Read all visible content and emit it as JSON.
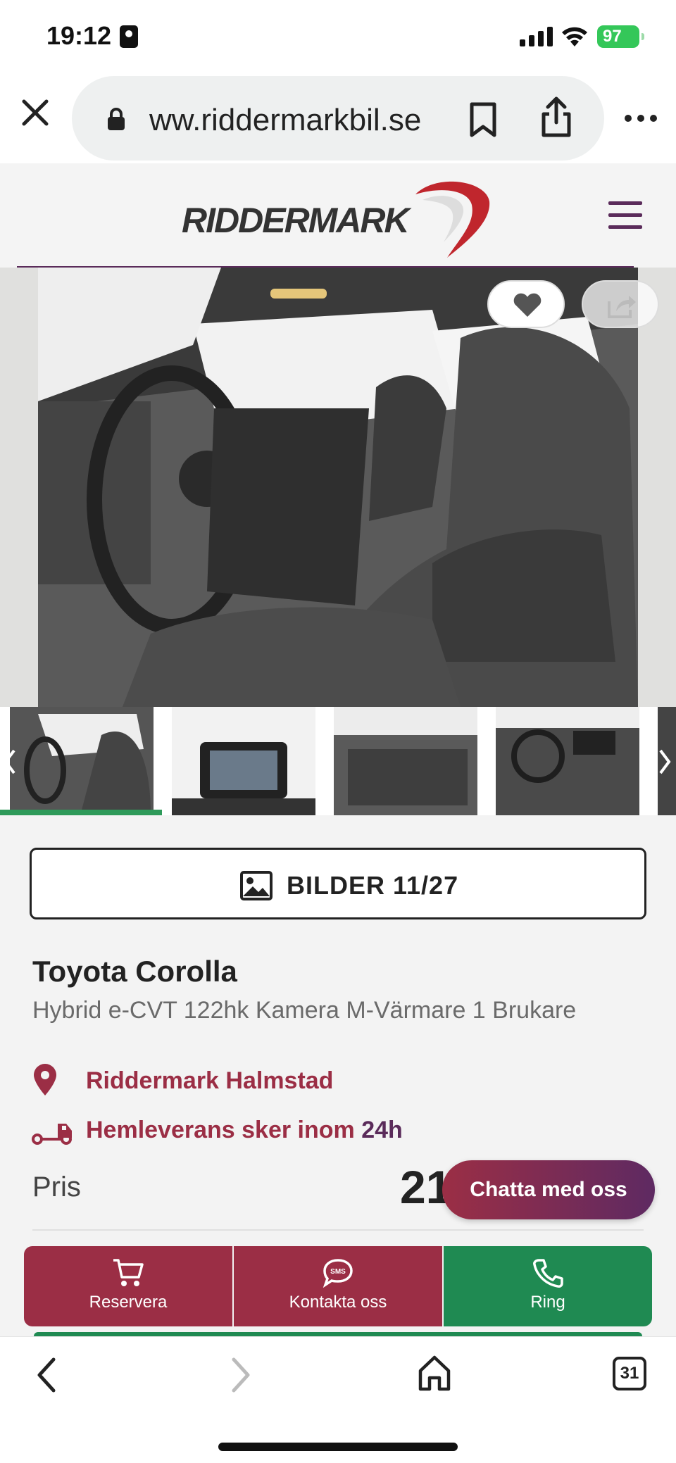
{
  "status_bar": {
    "time": "19:12",
    "battery": "97"
  },
  "browser": {
    "url": "ww.riddermarkbil.se",
    "tab_count": "31"
  },
  "site": {
    "logo_text": "RIDDERMARK",
    "brand_colors": {
      "primary": "#9b2e45",
      "accent": "#5a2b5a",
      "green": "#1f8a52"
    }
  },
  "gallery": {
    "images_button_label": "BILDER 11/27"
  },
  "listing": {
    "title": "Toyota Corolla",
    "subtitle": "Hybrid e-CVT 122hk Kamera M-Värmare 1 Brukare",
    "location": "Riddermark Halmstad",
    "delivery_text": "Hemleverans sker inom",
    "delivery_time": "24h",
    "price_label": "Pris",
    "price_value_partial": "21"
  },
  "chat": {
    "label": "Chatta med oss"
  },
  "actions": {
    "reserve": "Reservera",
    "contact": "Kontakta oss",
    "call": "Ring"
  }
}
